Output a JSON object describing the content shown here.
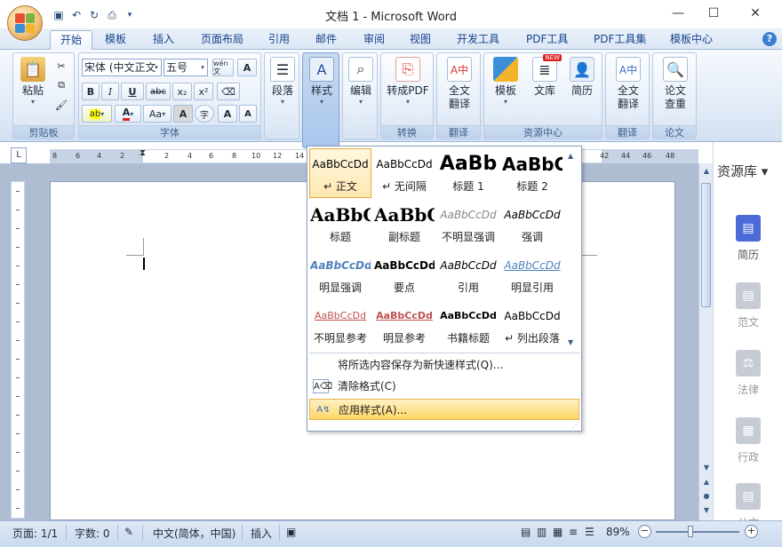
{
  "window": {
    "title": "文档 1 - Microsoft Word"
  },
  "quick_access": {
    "icons": [
      "save-icon",
      "undo-icon",
      "redo-icon",
      "print-icon",
      "customize-icon"
    ]
  },
  "tabs": [
    "开始",
    "模板",
    "插入",
    "页面布局",
    "引用",
    "邮件",
    "审阅",
    "视图",
    "开发工具",
    "PDF工具",
    "PDF工具集",
    "模板中心"
  ],
  "ribbon": {
    "clipboard": {
      "paste": "粘贴",
      "label": "剪贴板"
    },
    "font": {
      "name": "宋体 (中文正文",
      "size": "五号",
      "label": "字体",
      "wen": "wén 文",
      "a_box": "A",
      "bold": "B",
      "italic": "I",
      "underline": "U",
      "strike": "abc",
      "sub": "x₂",
      "sup": "x²",
      "case": "Aa",
      "char_a": "A",
      "circle": "字",
      "grow": "A",
      "shrink": "A",
      "highlight": "ab",
      "color": "A"
    },
    "paragraph": {
      "label": "段落"
    },
    "styles": {
      "label": "样式"
    },
    "edit": {
      "label": "编辑"
    },
    "convert": {
      "btn": "转成PDF",
      "label": "转换"
    },
    "translate": {
      "btn": "全文\n翻译",
      "label": "翻译"
    },
    "resource": {
      "template": "模板",
      "library": "文库",
      "resume": "简历",
      "new_badge": "NEW",
      "label": "资源中心"
    },
    "translate2": {
      "btn": "全文\n翻译",
      "label": "翻译"
    },
    "thesis": {
      "btn": "论文\n查重",
      "label": "论文"
    }
  },
  "ruler": {
    "corner": "L",
    "ticks": [
      "8",
      "6",
      "4",
      "2",
      "2",
      "4",
      "6",
      "8",
      "10",
      "12",
      "14",
      "42",
      "44",
      "46",
      "48"
    ]
  },
  "styles_dropdown": {
    "gallery": [
      {
        "preview": "AaBbCcDd",
        "name": "↵ 正文",
        "selected": true
      },
      {
        "preview": "AaBbCcDd",
        "name": "↵ 无间隔"
      },
      {
        "preview": "AaBb",
        "name": "标题 1"
      },
      {
        "preview": "AaBbC",
        "name": "标题 2"
      },
      {
        "preview": "AaBbC",
        "name": "标题"
      },
      {
        "preview": "AaBbC",
        "name": "副标题"
      },
      {
        "preview": "AaBbCcDd",
        "name": "不明显强调"
      },
      {
        "preview": "AaBbCcDd",
        "name": "强调"
      },
      {
        "preview": "AaBbCcDd",
        "name": "明显强调"
      },
      {
        "preview": "AaBbCcDd",
        "name": "要点"
      },
      {
        "preview": "AaBbCcDd",
        "name": "引用"
      },
      {
        "preview": "AaBbCcDd",
        "name": "明显引用"
      },
      {
        "preview": "AaBbCcDd",
        "name": "不明显参考"
      },
      {
        "preview": "AaBbCcDd",
        "name": "明显参考"
      },
      {
        "preview": "AaBbCcDd",
        "name": "书籍标题"
      },
      {
        "preview": "AaBbCcDd",
        "name": "↵ 列出段落"
      }
    ],
    "actions": [
      "将所选内容保存为新快速样式(Q)...",
      "清除格式(C)",
      "应用样式(A)..."
    ]
  },
  "resource_panel": {
    "title": "资源库 ▾",
    "items": [
      "简历",
      "范文",
      "法律",
      "行政",
      "公文"
    ]
  },
  "status": {
    "page": "页面: 1/1",
    "words": "字数: 0",
    "language": "中文(简体，中国)",
    "mode": "插入",
    "zoom": "89%",
    "zoom_minus": "−",
    "zoom_plus": "+"
  },
  "colors": {
    "accent": "#15428b",
    "highlight": "#ffd767",
    "ribbon": "#dfe9f6"
  }
}
